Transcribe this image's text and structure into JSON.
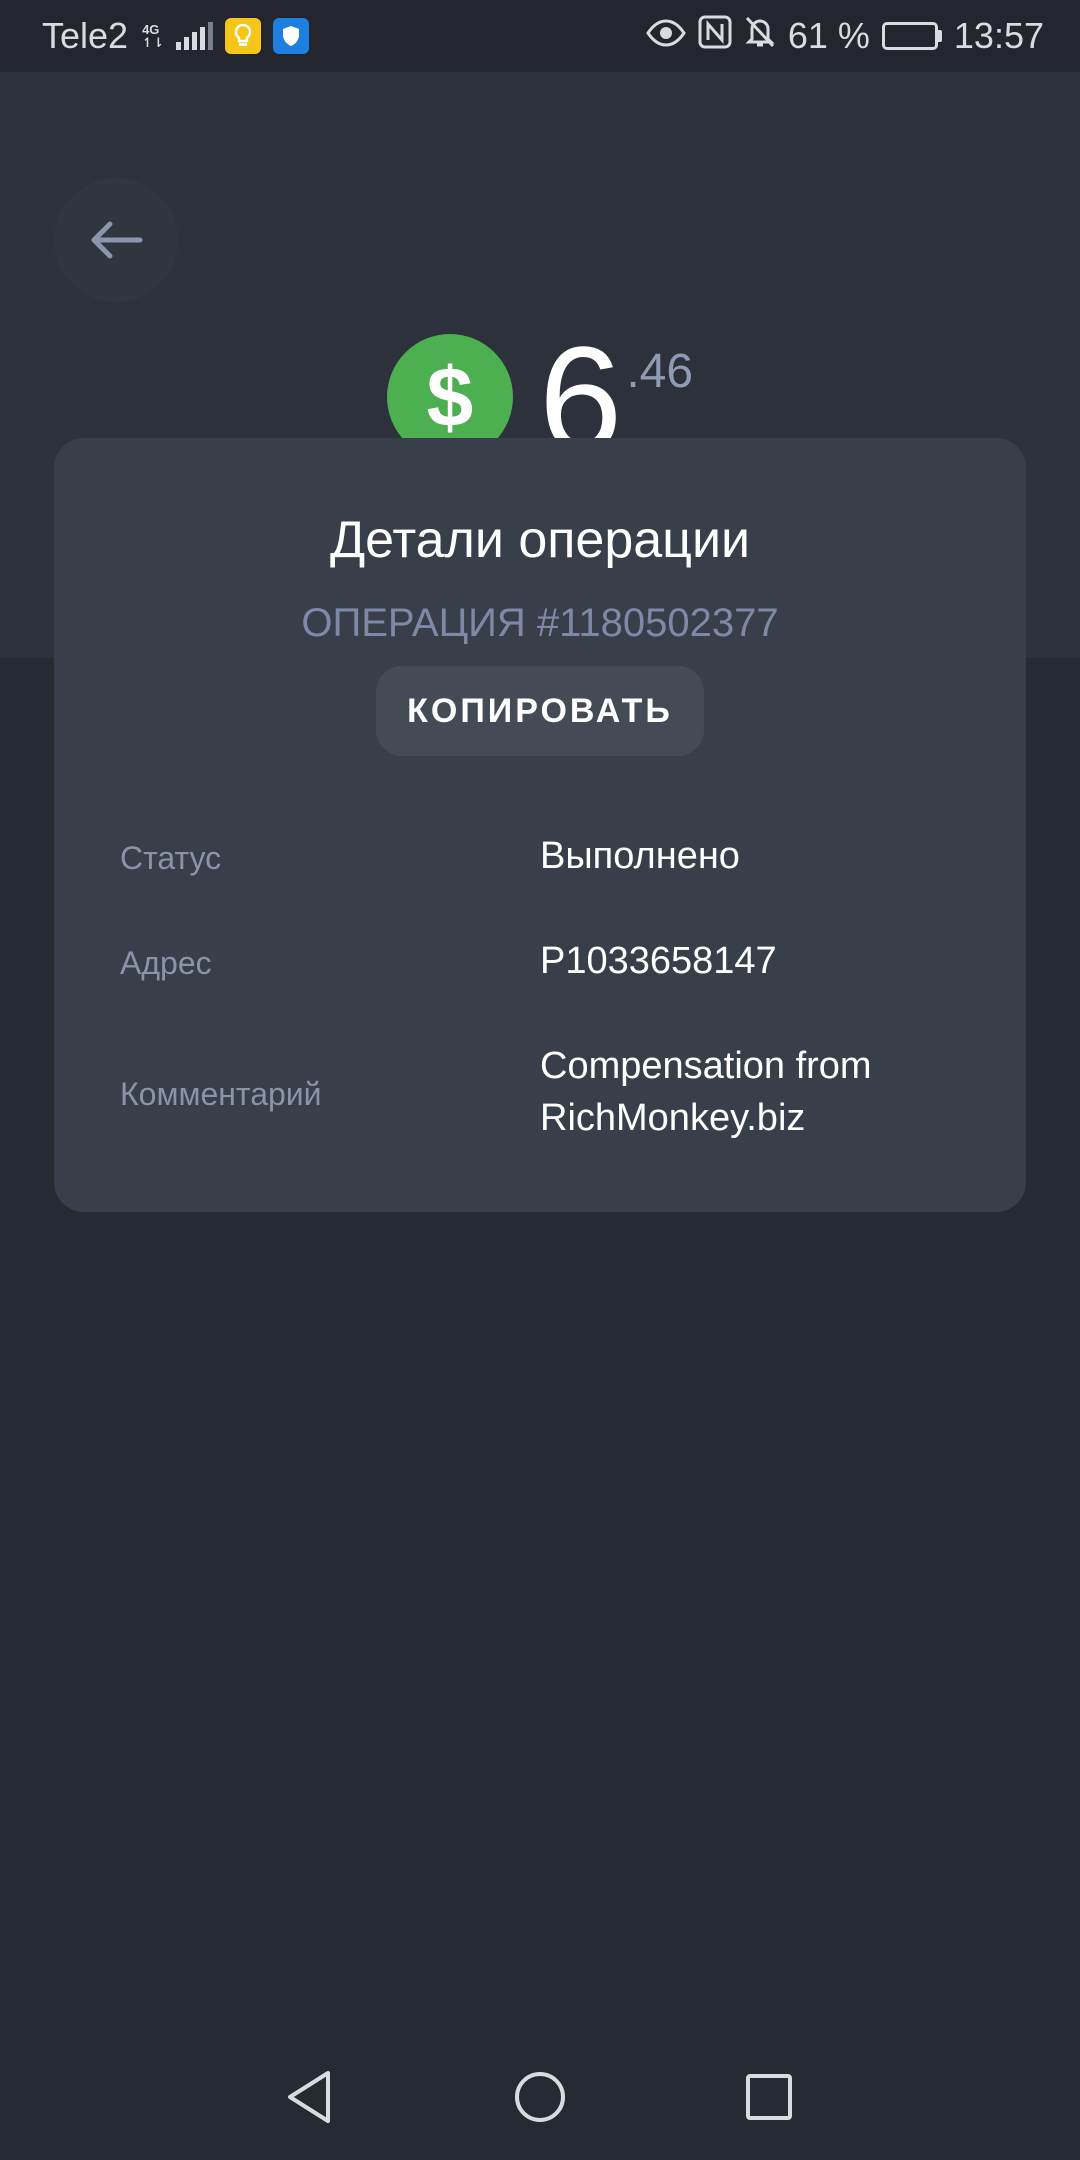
{
  "status_bar": {
    "carrier": "Tele2",
    "network": "4G",
    "battery_percent": "61 %",
    "battery_level": 0.61,
    "time": "13:57"
  },
  "header": {
    "amount_integer": "6",
    "amount_fraction": ".46",
    "currency_symbol": "$",
    "currency_color": "#4caf50"
  },
  "card": {
    "title": "Детали операции",
    "operation_number": "ОПЕРАЦИЯ #1180502377",
    "copy_label": "КОПИРОВАТЬ",
    "rows": [
      {
        "label": "Статус",
        "value": "Выполнено"
      },
      {
        "label": "Адрес",
        "value": "P1033658147"
      },
      {
        "label": "Комментарий",
        "value": "Compensation from RichMonkey.biz"
      }
    ]
  },
  "icons": {
    "back": "arrow-left-icon",
    "eye": "eye-icon",
    "nfc": "nfc-icon",
    "mute": "bell-off-icon",
    "nav_back": "triangle-back-icon",
    "nav_home": "circle-home-icon",
    "nav_recent": "square-recent-icon"
  }
}
